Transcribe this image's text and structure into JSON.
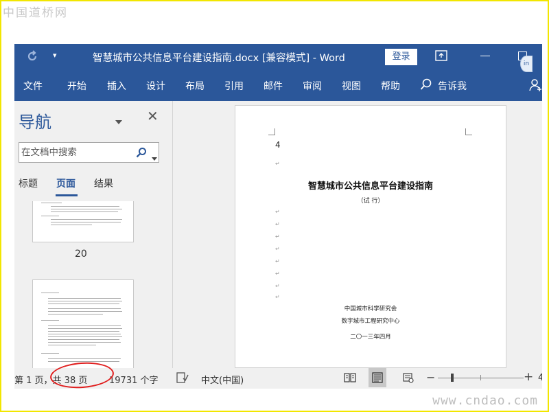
{
  "watermarks": {
    "top": "中国道桥网",
    "bottom": "www.cndao.com"
  },
  "titlebar": {
    "qat_more": "▾",
    "title": "智慧城市公共信息平台建设指南.docx [兼容模式]  -  Word",
    "login_label": "登录"
  },
  "menu": {
    "items": [
      "文件",
      "开始",
      "插入",
      "设计",
      "布局",
      "引用",
      "邮件",
      "审阅",
      "视图",
      "帮助"
    ],
    "tell_me": "告诉我"
  },
  "nav": {
    "title": "导航",
    "close": "✕",
    "search_placeholder": "在文档中搜索",
    "tabs": [
      "标题",
      "页面",
      "结果"
    ],
    "active_tab": "页面",
    "thumb_label": "20"
  },
  "document": {
    "page_mark": "4",
    "title": "智慧城市公共信息平台建设指南",
    "subtitle": "（试  行）",
    "org1": "中国城市科学研究会",
    "org2": "数字城市工程研究中心",
    "date": "二〇一三年四月"
  },
  "status": {
    "page": "第 1 页，共 38 页",
    "words": "19731 个字",
    "language": "中文(中国)",
    "zoom_minus": "−",
    "zoom_plus": "+",
    "zoom_pct": "4"
  },
  "colors": {
    "word_blue": "#2b579a",
    "frame_yellow": "#f2e600",
    "annotation_red": "#e01e1e"
  }
}
